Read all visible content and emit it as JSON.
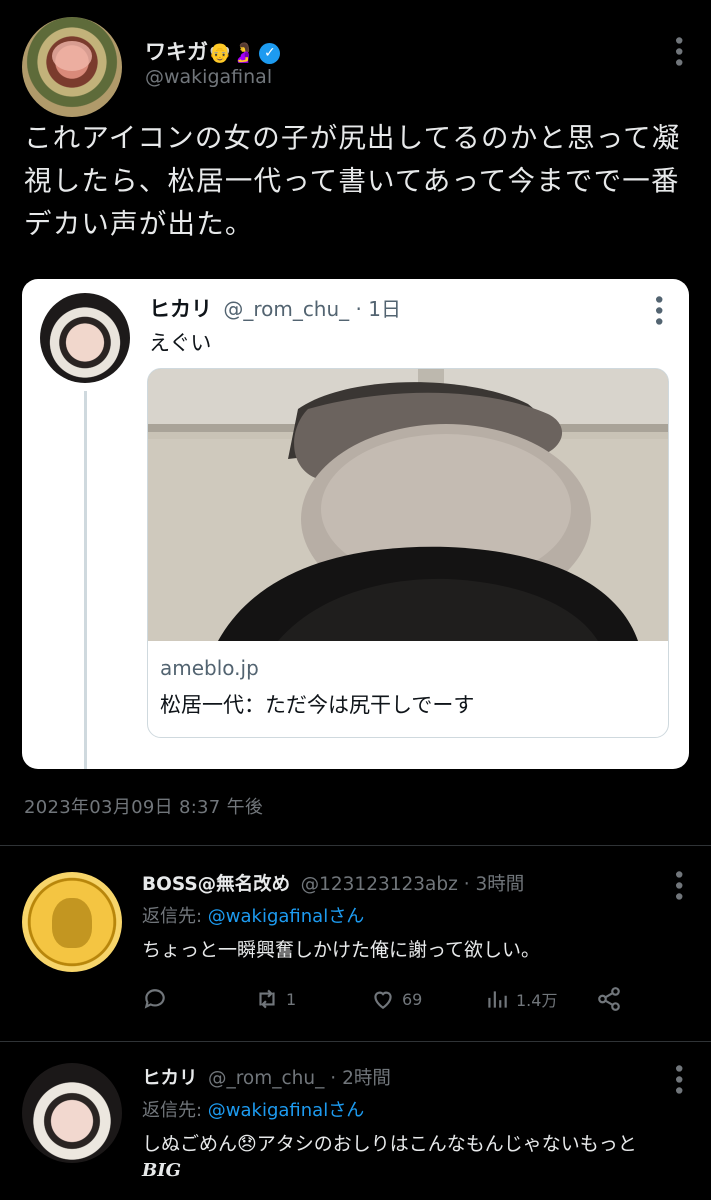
{
  "tweet": {
    "display_name": "ワキガ",
    "name_emojis": "👴🤰",
    "handle": "@wakigafinal",
    "text": "これアイコンの女の子が尻出してるのかと思って凝視したら、松居一代って書いてあって今までで一番デカい声が出た。",
    "timestamp": "2023年03月09日 8:37 午後"
  },
  "quote": {
    "display_name": "ヒカリ",
    "handle": "@_rom_chu_",
    "separator": "·",
    "age": "1日",
    "text": "えぐい",
    "link_domain": "ameblo.jp",
    "link_title": "松居一代：ただ今は尻干しでーす"
  },
  "replies": [
    {
      "display_name": "BOSS@無名改め",
      "handle": "@123123123abz",
      "separator": "·",
      "age": "3時間",
      "reply_prefix": "返信先: ",
      "reply_mention": "@wakigafinalさん",
      "text": "ちょっと一瞬興奮しかけた俺に謝って欲しい。",
      "actions": {
        "retweets": "1",
        "likes": "69",
        "views": "1.4万"
      }
    },
    {
      "display_name": "ヒカリ",
      "handle": "@_rom_chu_",
      "separator": "·",
      "age": "2時間",
      "reply_prefix": "返信先: ",
      "reply_mention": "@wakigafinalさん",
      "text": "しぬごめん😞アタシのおしりはこんなもんじゃないもっと",
      "text_big": "BIG"
    }
  ],
  "icons": {
    "verified": "verified-badge-icon",
    "more": "more-icon",
    "reply": "reply-icon",
    "retweet": "retweet-icon",
    "like": "like-icon",
    "views": "views-icon",
    "share": "share-icon"
  },
  "colors": {
    "background": "#000000",
    "accent": "#1d9bf0",
    "secondary_text": "#71767b",
    "card_background": "#ffffff"
  }
}
